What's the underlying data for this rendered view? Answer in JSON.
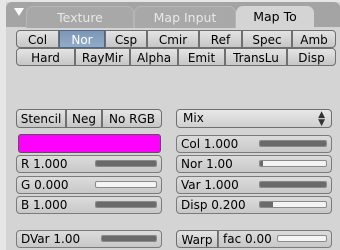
{
  "tabs": {
    "texture": "Texture",
    "map_input": "Map Input",
    "map_to": "Map To"
  },
  "channels_row1": [
    "Col",
    "Nor",
    "Csp",
    "Cmir",
    "Ref",
    "Spec",
    "Amb"
  ],
  "channels_row2": [
    "Hard",
    "RayMir",
    "Alpha",
    "Emit",
    "TransLu",
    "Disp"
  ],
  "toggles": {
    "stencil": "Stencil",
    "neg": "Neg",
    "no_rgb": "No RGB"
  },
  "blend_mode": "Mix",
  "color_swatch": "#ff00ff",
  "rgb": {
    "r": {
      "label": "R 1.000",
      "value": 1.0
    },
    "g": {
      "label": "G 0.000",
      "value": 0.0
    },
    "b": {
      "label": "B 1.000",
      "value": 1.0
    }
  },
  "factors": {
    "col": {
      "label": "Col 1.000",
      "value": 1.0
    },
    "nor": {
      "label": "Nor 1.00",
      "value": 0.04
    },
    "var": {
      "label": "Var 1.000",
      "value": 1.0
    },
    "disp": {
      "label": "Disp 0.200",
      "value": 0.2
    }
  },
  "dvar": {
    "label": "DVar 1.00",
    "value": 1.0
  },
  "warp": {
    "label": "Warp",
    "fac_label": "fac 0.00",
    "fac_value": 0.0
  },
  "colors": {
    "selected": "#7c97b6",
    "panel": "#d4d4d4",
    "header": "#a4a4a4"
  }
}
